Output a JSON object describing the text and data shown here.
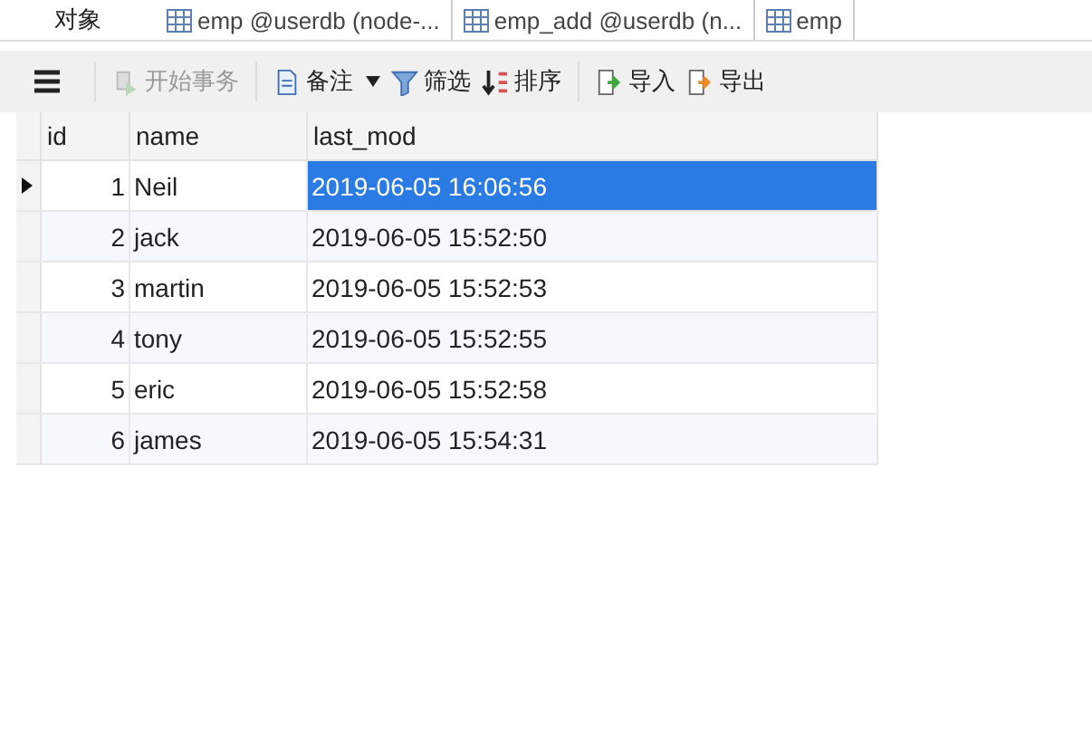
{
  "tabs": [
    {
      "label": "对象",
      "kind": "objects"
    },
    {
      "label": "emp @userdb (node-...",
      "kind": "table"
    },
    {
      "label": "emp_add @userdb (n...",
      "kind": "table"
    },
    {
      "label": "emp",
      "kind": "table"
    }
  ],
  "toolbar": [
    {
      "label": "开始事务",
      "kind": "transaction",
      "disabled": true,
      "dropdown": false
    },
    {
      "label": "备注",
      "kind": "note",
      "disabled": false,
      "dropdown": true
    },
    {
      "label": "筛选",
      "kind": "filter",
      "disabled": false,
      "dropdown": false
    },
    {
      "label": "排序",
      "kind": "sort",
      "disabled": false,
      "dropdown": false
    },
    {
      "label": "导入",
      "kind": "import",
      "disabled": false,
      "dropdown": false
    },
    {
      "label": "导出",
      "kind": "export",
      "disabled": false,
      "dropdown": false
    }
  ],
  "table": {
    "columns": [
      "id",
      "name",
      "last_mod"
    ],
    "rows": [
      {
        "cells": [
          "1",
          "Neil",
          "2019-06-05 16:06:56"
        ],
        "current": true,
        "selected": true
      },
      {
        "cells": [
          "2",
          "jack",
          "2019-06-05 15:52:50"
        ],
        "current": false,
        "selected": false
      },
      {
        "cells": [
          "3",
          "martin",
          "2019-06-05 15:52:53"
        ],
        "current": false,
        "selected": false
      },
      {
        "cells": [
          "4",
          "tony",
          "2019-06-05 15:52:55"
        ],
        "current": false,
        "selected": false
      },
      {
        "cells": [
          "5",
          "eric",
          "2019-06-05 15:52:58"
        ],
        "current": false,
        "selected": false
      },
      {
        "cells": [
          "6",
          "james",
          "2019-06-05 15:54:31"
        ],
        "current": false,
        "selected": false
      }
    ]
  }
}
